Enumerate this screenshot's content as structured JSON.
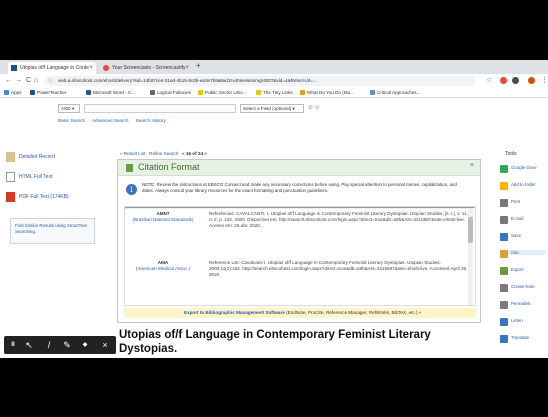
{
  "browser": {
    "tabs": [
      {
        "title": "Utopias of/f Language in Conte",
        "close": "×",
        "active": true
      },
      {
        "title": "Your Screencasts - Screencastify",
        "close": "×",
        "active": false
      }
    ],
    "new_tab": "+",
    "address": "web.a.ebscohost.com/ehost/delivery?sid=14b87ce4-31ed-4b15-8c0b-ea3e7b9a8ad1%40sessionmgr4007&vid=4&ReturnUrl=...",
    "nav": {
      "back": "←",
      "forward": "→",
      "reload": "C",
      "home": "⌂"
    },
    "bookmarks": [
      {
        "label": "Apps",
        "color": "#4285f4"
      },
      {
        "label": "PowerTeacher",
        "color": "#1d4f91"
      },
      {
        "label": "Microsoft Word - C...",
        "color": "#2b579a"
      },
      {
        "label": "Logical Fallacies",
        "color": "#666666"
      },
      {
        "label": "Public Sector Unio...",
        "color": "#f2c200"
      },
      {
        "label": "The Tiny Links",
        "color": "#f2c200"
      },
      {
        "label": "What Do You Do (Mu...",
        "color": "#e6a100"
      },
      {
        "label": "Critical Approaches...",
        "color": "#5a8fd6"
      }
    ]
  },
  "search": {
    "bool_select": "AND",
    "field_select": "Select a Field (optional)",
    "links": [
      "Basic Search",
      "Advanced Search",
      "Search History"
    ]
  },
  "left": {
    "detailed_record": "Detailed Record",
    "html_full_text": "HTML Full Text",
    "pdf_full_text": "PDF Full Text (174KB)",
    "find_similar": "Find Similar Results using SmartText Searching."
  },
  "result_nav": {
    "prev": "« Result List",
    "refine": "Refine Search",
    "pager": "« 16 of 24 »"
  },
  "citation": {
    "title": "Citation Format",
    "note": "NOTE: Review the instructions at EBSCO Connect and make any necessary corrections before using. Pay special attention to personal names, capitalization, and dates. Always consult your library resources for the exact formatting and punctuation guidelines.",
    "entries": [
      {
        "style": "AMN7",
        "style_full": "(Brazilian National Standards)",
        "text": "Referências: CAVALCANTI, I. Utopias of/f Language in Contemporary Feminist Literary Dystopias. Utopian Studies, [s. l.], v. 11, n. 2, p. 152, 2000. Disponível em: http://search.ebscohost.com/login.aspx?direct=true&db=a9h&AN=4215587&site=ehost-live. Acesso em: 26 abr. 2020."
      },
      {
        "style": "AMA",
        "style_full": "(American Medical Assoc.)",
        "text": "Reference List: Cavalcanti I. Utopias of/f Language in Contemporary Feminist Literary Dystopias. Utopian Studies. 2000;11(2):152. http://search.ebscohost.com/login.aspx?direct=true&db=a9h&AN=4215587&site=ehost-live. Accessed April 26, 2020."
      }
    ],
    "export_label": "Export to Bibliographic Management Software",
    "export_tools": "(EndNote, ProCite, Reference Manager, RefWorks, BibTeX, etc.) »",
    "close": "×"
  },
  "doc_title": "Utopias of/f Language in Contemporary Feminist Literary Dystopias.",
  "tools": {
    "header": "Tools",
    "items": [
      {
        "label": "Google Drive",
        "color": "#34a853"
      },
      {
        "label": "Add to folder",
        "color": "#f4b400"
      },
      {
        "label": "Print",
        "color": "#777777"
      },
      {
        "label": "E-mail",
        "color": "#777777"
      },
      {
        "label": "Save",
        "color": "#3a74c4"
      },
      {
        "label": "Cite",
        "color": "#e0a030"
      },
      {
        "label": "Export",
        "color": "#6a9a3c"
      },
      {
        "label": "Create Note",
        "color": "#7a7a7a"
      },
      {
        "label": "Permalink",
        "color": "#7a7a7a"
      },
      {
        "label": "Listen",
        "color": "#3a74c4"
      },
      {
        "label": "Translate",
        "color": "#3a74c4"
      }
    ]
  },
  "video_toolbar": {
    "pause": "II",
    "pointer": "↖",
    "pen": "/",
    "highlighter": "✎",
    "eraser": "◆",
    "close": "×"
  }
}
